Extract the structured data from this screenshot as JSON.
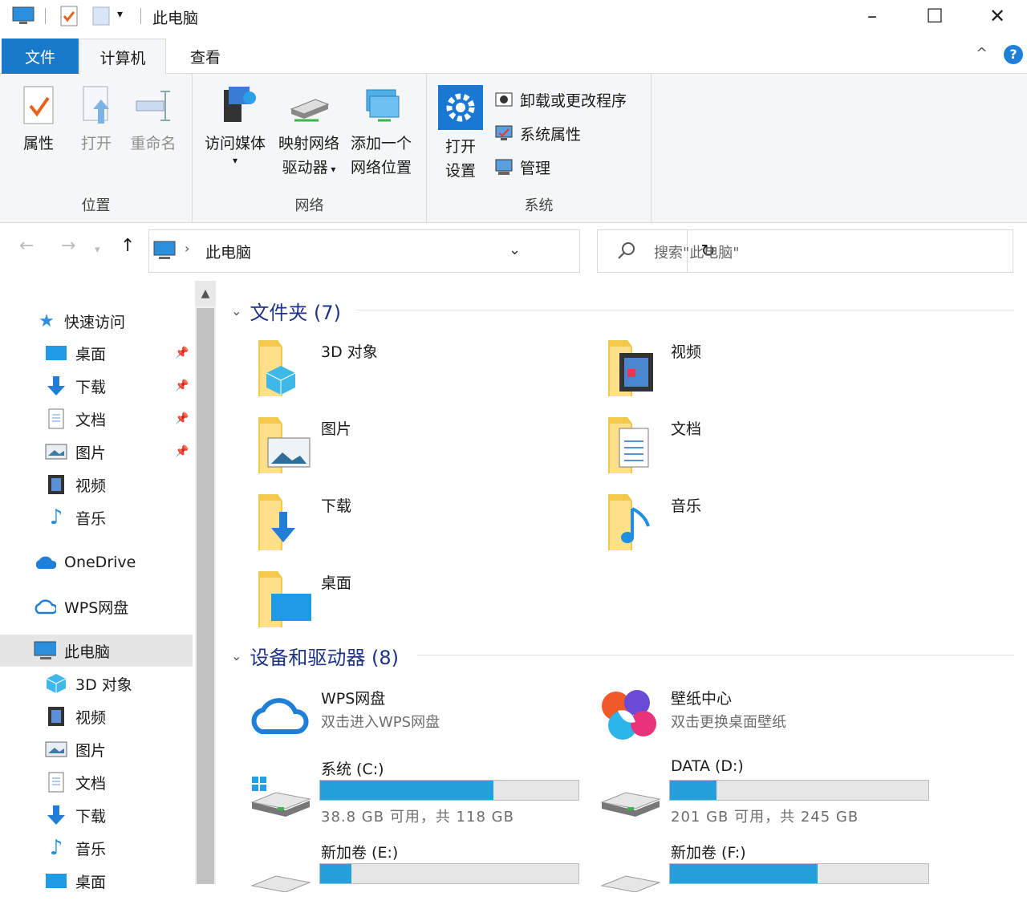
{
  "window": {
    "title": "此电脑"
  },
  "tabs": {
    "file": "文件",
    "computer": "计算机",
    "view": "查看"
  },
  "help_label": "?",
  "ribbon": {
    "location": {
      "label": "位置",
      "properties": "属性",
      "open": "打开",
      "rename": "重命名"
    },
    "network": {
      "label": "网络",
      "media": "访问媒体",
      "map_drive_1": "映射网络",
      "map_drive_2": "驱动器",
      "add_location_1": "添加一个",
      "add_location_2": "网络位置"
    },
    "system": {
      "label": "系统",
      "open_settings_1": "打开",
      "open_settings_2": "设置",
      "uninstall": "卸载或更改程序",
      "sys_props": "系统属性",
      "manage": "管理"
    }
  },
  "nav": {
    "path": "此电脑",
    "search_placeholder": "搜索\"此电脑\""
  },
  "sidebar": [
    {
      "label": "快速访问",
      "icon": "star-icon",
      "group": true
    },
    {
      "label": "桌面",
      "icon": "desktop-icon",
      "pinned": true
    },
    {
      "label": "下载",
      "icon": "download-icon",
      "pinned": true
    },
    {
      "label": "文档",
      "icon": "document-icon",
      "pinned": true
    },
    {
      "label": "图片",
      "icon": "picture-icon",
      "pinned": true
    },
    {
      "label": "视频",
      "icon": "video-icon"
    },
    {
      "label": "音乐",
      "icon": "music-icon"
    },
    {
      "label": "OneDrive",
      "icon": "cloud-icon",
      "group": true
    },
    {
      "label": "WPS网盘",
      "icon": "wps-cloud-icon",
      "group": true
    },
    {
      "label": "此电脑",
      "icon": "computer-icon",
      "group": true,
      "selected": true
    },
    {
      "label": "3D 对象",
      "icon": "cube-icon"
    },
    {
      "label": "视频",
      "icon": "video-icon"
    },
    {
      "label": "图片",
      "icon": "picture-icon"
    },
    {
      "label": "文档",
      "icon": "document-icon"
    },
    {
      "label": "下载",
      "icon": "download-icon"
    },
    {
      "label": "音乐",
      "icon": "music-icon"
    },
    {
      "label": "桌面",
      "icon": "desktop-icon"
    }
  ],
  "folders": {
    "header": "文件夹 (7)",
    "items": [
      "3D 对象",
      "视频",
      "图片",
      "文档",
      "下载",
      "音乐",
      "桌面"
    ]
  },
  "devices": {
    "header": "设备和驱动器 (8)",
    "wps": {
      "name": "WPS网盘",
      "sub": "双击进入WPS网盘"
    },
    "wallpaper": {
      "name": "壁纸中心",
      "sub": "双击更换桌面壁纸"
    },
    "drives": [
      {
        "name": "系统 (C:)",
        "free": "38.8 GB 可用，共 118 GB",
        "used_fraction": 0.67
      },
      {
        "name": "DATA (D:)",
        "free": "201 GB 可用，共 245 GB",
        "used_fraction": 0.18
      },
      {
        "name": "新加卷 (E:)",
        "free": "",
        "used_fraction": 0.12
      },
      {
        "name": "新加卷 (F:)",
        "free": "",
        "used_fraction": 0.57
      }
    ]
  },
  "colors": {
    "accent": "#1979ca",
    "drive_bar": "#26a0da",
    "section_header": "#1e3287"
  }
}
